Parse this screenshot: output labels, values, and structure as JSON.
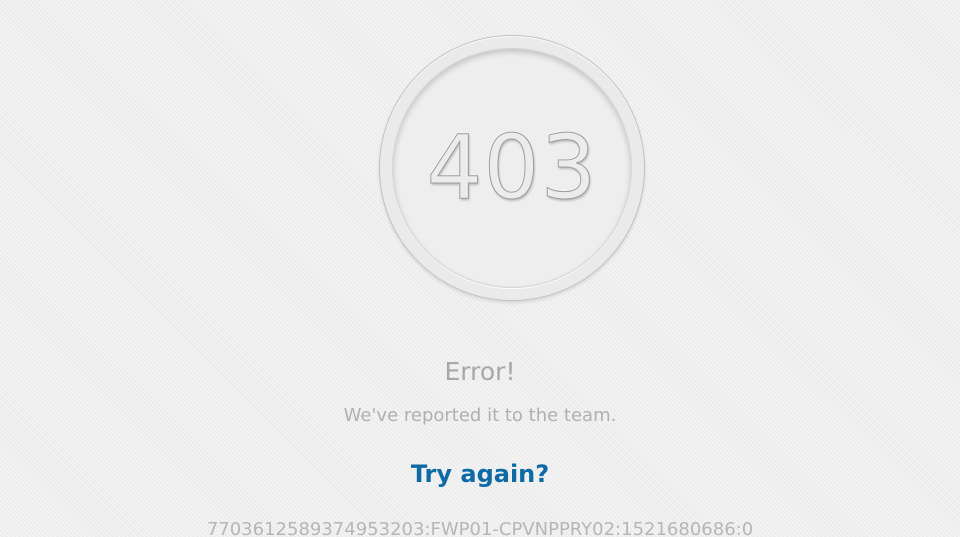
{
  "status_code": "403",
  "error": {
    "title": "Error!",
    "message": "We've reported it to the team."
  },
  "actions": {
    "retry_label": "Try again?"
  },
  "request_id": "7703612589374953203:FWP01-CPVNPPRY02:1521680686:0",
  "colors": {
    "background": "#ececec",
    "link": "#0d6aa5",
    "muted_text": "#a7a7a7"
  }
}
